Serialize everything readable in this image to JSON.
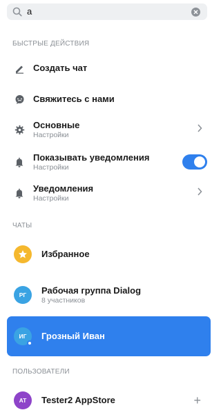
{
  "search": {
    "query": "а"
  },
  "quick_actions": {
    "title": "БЫСТРЫЕ ДЕЙСТВИЯ",
    "items": [
      {
        "label": "Создать чат",
        "icon": "pencil-icon"
      },
      {
        "label": "Свяжитесь с нами",
        "icon": "chat-bubble-icon"
      },
      {
        "label": "Основные",
        "sub": "Настройки",
        "icon": "gear-icon"
      },
      {
        "label": "Показывать уведомления",
        "sub": "Настройки",
        "icon": "bell-icon",
        "toggle_on": true
      },
      {
        "label": "Уведомления",
        "sub": "Настройки",
        "icon": "bell-icon"
      }
    ]
  },
  "chats": {
    "title": "ЧАТЫ",
    "items": [
      {
        "label": "Избранное",
        "avatar_icon": "star-icon",
        "color": "#f5b82e"
      },
      {
        "label": "Рабочая группа Dialog",
        "sub": "8 участников",
        "initials": "РГ",
        "color": "#3aa3e3"
      },
      {
        "label": "Грозный Иван",
        "initials": "ИГ",
        "color": "#3aa3e3",
        "selected": true
      }
    ]
  },
  "users": {
    "title": "ПОЛЬЗОВАТЕЛИ",
    "items": [
      {
        "label": "Tester2 AppStore",
        "initials": "AT",
        "color": "#8e44c9"
      }
    ]
  },
  "colors": {
    "accent": "#2f80ed",
    "muted": "#8a8f95"
  }
}
